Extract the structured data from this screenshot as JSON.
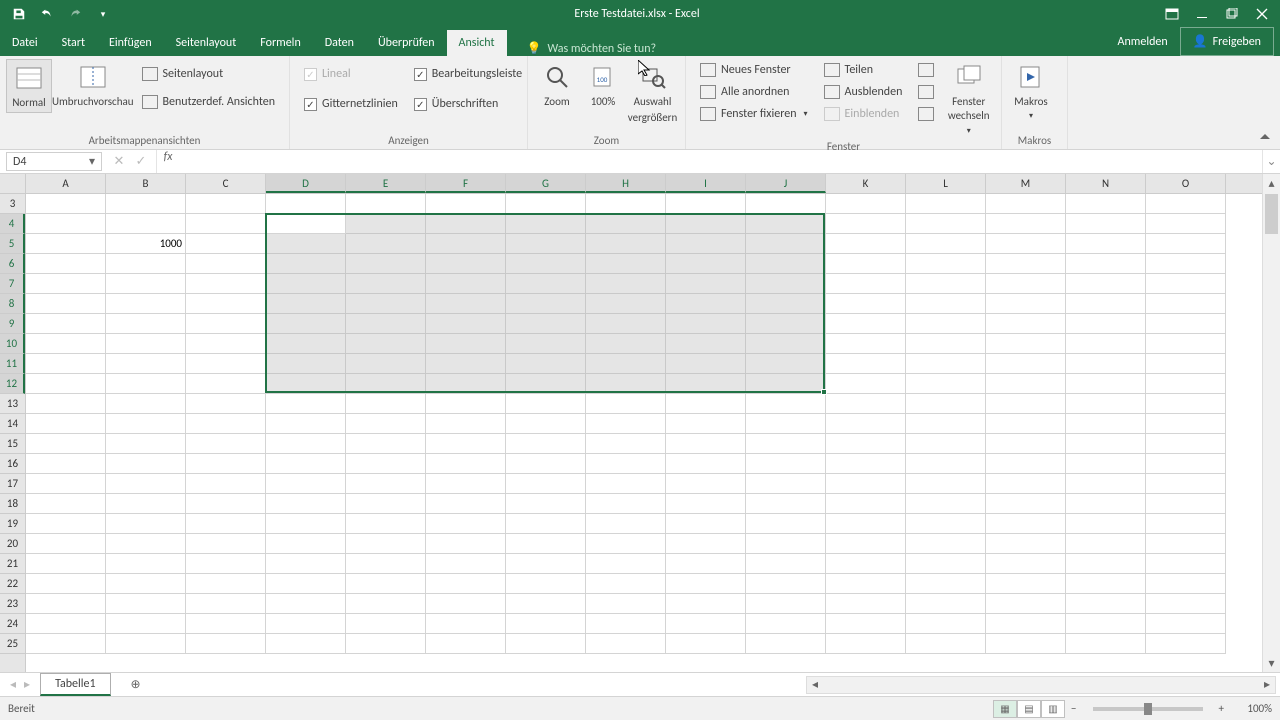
{
  "title": "Erste Testdatei.xlsx - Excel",
  "tabs": {
    "file": "Datei",
    "items": [
      "Start",
      "Einfügen",
      "Seitenlayout",
      "Formeln",
      "Daten",
      "Überprüfen",
      "Ansicht"
    ],
    "active": "Ansicht",
    "tellme": "Was möchten Sie tun?",
    "signin": "Anmelden",
    "share": "Freigeben"
  },
  "ribbon": {
    "views": {
      "normal": "Normal",
      "pagebreak": "Umbruchvorschau",
      "pagelayout": "Seitenlayout",
      "custom": "Benutzerdef. Ansichten",
      "label": "Arbeitsmappenansichten"
    },
    "show": {
      "ruler": "Lineal",
      "formula": "Bearbeitungsleiste",
      "gridlines": "Gitternetzlinien",
      "headings": "Überschriften",
      "label": "Anzeigen"
    },
    "zoom": {
      "zoom": "Zoom",
      "hundred": "100%",
      "selection1": "Auswahl",
      "selection2": "vergrößern",
      "label": "Zoom"
    },
    "window": {
      "newwin": "Neues Fenster",
      "arrange": "Alle anordnen",
      "freeze": "Fenster fixieren",
      "split": "Teilen",
      "hide": "Ausblenden",
      "unhide": "Einblenden",
      "switch": "Fenster wechseln",
      "label": "Fenster"
    },
    "macros": {
      "macros": "Makros",
      "label": "Makros"
    }
  },
  "namebox": "D4",
  "formula": "",
  "columns": [
    "A",
    "B",
    "C",
    "D",
    "E",
    "F",
    "G",
    "H",
    "I",
    "J",
    "K",
    "L",
    "M",
    "N",
    "O"
  ],
  "sel_cols": [
    "D",
    "E",
    "F",
    "G",
    "H",
    "I",
    "J"
  ],
  "first_row": 3,
  "last_row": 25,
  "sel_rows": [
    4,
    5,
    6,
    7,
    8,
    9,
    10,
    11,
    12
  ],
  "cell_b5": "1000",
  "sheet": "Tabelle1",
  "status": "Bereit",
  "zoom": "100%",
  "chart_data": null
}
